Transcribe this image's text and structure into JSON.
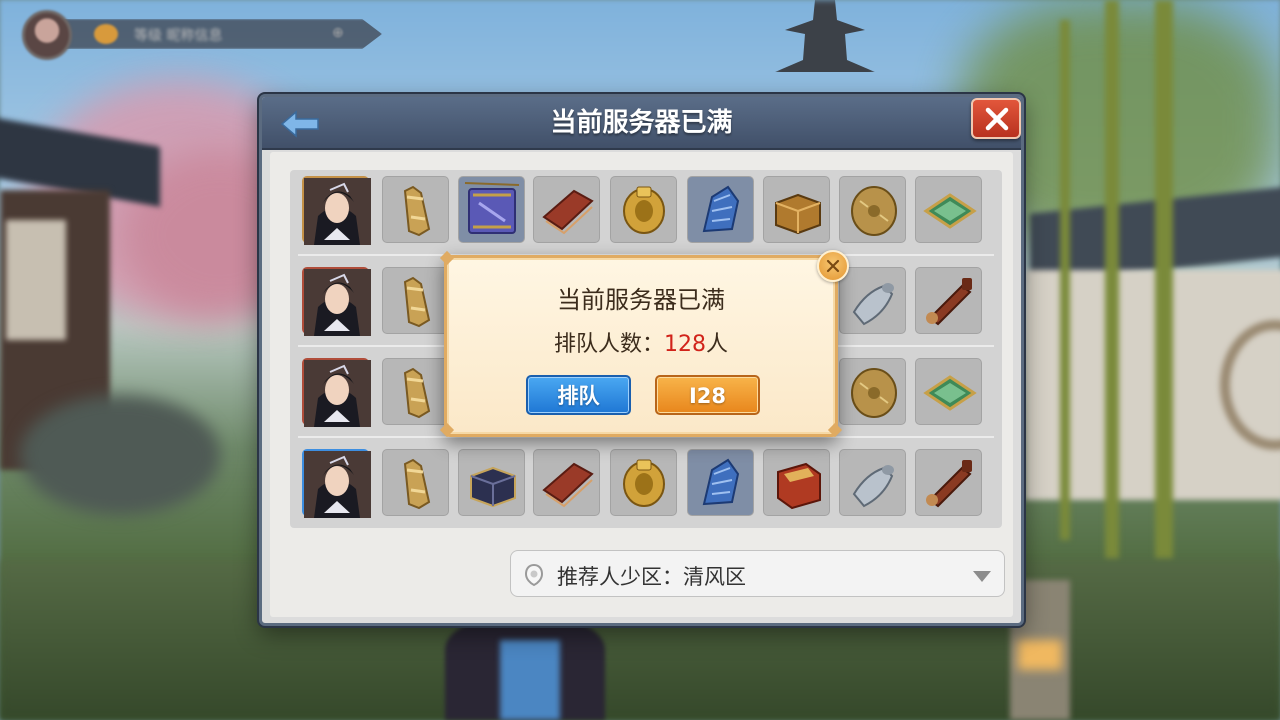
{
  "hud": {
    "player_info": "等级 昵称信息"
  },
  "dialog": {
    "title": "当前服务器已满",
    "recommend": {
      "label": "推荐人少区：",
      "server": "清风区"
    },
    "rows": [
      {
        "portrait_frame": "gold",
        "items": [
          "gold-bottle",
          "blue-scroll",
          "red-book",
          "gold-ring",
          "blue-cloth",
          "wood-chest",
          "bronze-coin",
          "green-box"
        ]
      },
      {
        "portrait_frame": "red",
        "items": [
          "gold-bottle",
          "hidden",
          "hidden",
          "hidden",
          "hidden",
          "hidden",
          "silver-vase",
          "brown-scroll"
        ]
      },
      {
        "portrait_frame": "red",
        "items": [
          "gold-bottle",
          "hidden",
          "hidden",
          "hidden",
          "hidden",
          "hidden",
          "bronze-coin",
          "green-box"
        ]
      },
      {
        "portrait_frame": "blue",
        "items": [
          "gold-bottle",
          "navy-box",
          "red-book",
          "gold-ring",
          "blue-cloth",
          "red-chest",
          "silver-vase",
          "brown-scroll"
        ]
      }
    ]
  },
  "popup": {
    "title": "当前服务器已满",
    "queue_label": "排队人数：",
    "queue_count": "128",
    "queue_unit": "人",
    "queue_button": "排队",
    "count_button": "I28"
  },
  "colors": {
    "header": "#4a5a76",
    "close_red": "#c83d26",
    "popup_border": "#e0ab62",
    "queue_count": "#d1231a",
    "btn_blue": "#2a86dc",
    "btn_orange": "#f09a2c"
  }
}
